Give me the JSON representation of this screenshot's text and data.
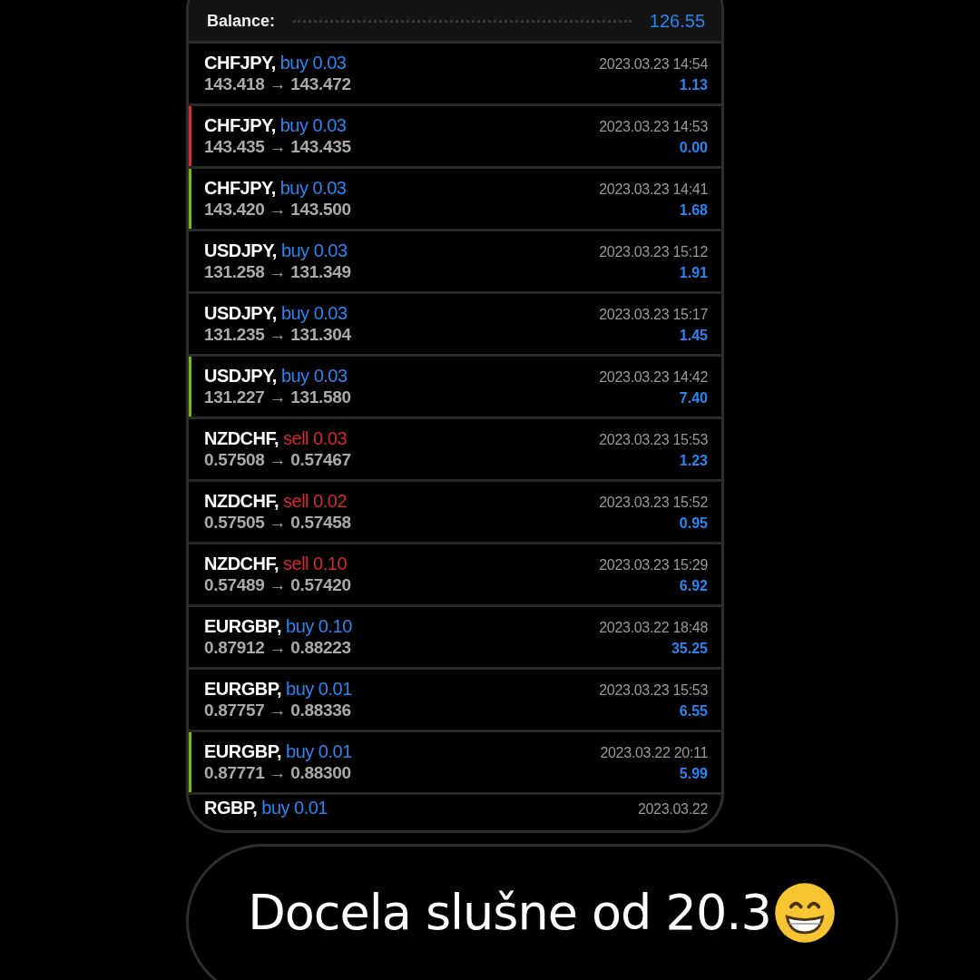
{
  "balance": {
    "label": "Balance:",
    "value": "126.55"
  },
  "trades": [
    {
      "symbol": "CHFJPY,",
      "order": "buy 0.03",
      "kind": "buy",
      "prices": "143.418 → 143.472",
      "time": "2023.03.23 14:54",
      "profit": "1.13"
    },
    {
      "symbol": "CHFJPY,",
      "order": "buy 0.03",
      "kind": "buy",
      "prices": "143.435 → 143.435",
      "time": "2023.03.23 14:53",
      "profit": "0.00",
      "color": "#d32f2f"
    },
    {
      "symbol": "CHFJPY,",
      "order": "buy 0.03",
      "kind": "buy",
      "prices": "143.420 → 143.500",
      "time": "2023.03.23 14:41",
      "profit": "1.68",
      "color": "#7cb518"
    },
    {
      "symbol": "USDJPY,",
      "order": "buy 0.03",
      "kind": "buy",
      "prices": "131.258 → 131.349",
      "time": "2023.03.23 15:12",
      "profit": "1.91"
    },
    {
      "symbol": "USDJPY,",
      "order": "buy 0.03",
      "kind": "buy",
      "prices": "131.235 → 131.304",
      "time": "2023.03.23 15:17",
      "profit": "1.45"
    },
    {
      "symbol": "USDJPY,",
      "order": "buy 0.03",
      "kind": "buy",
      "prices": "131.227 → 131.580",
      "time": "2023.03.23 14:42",
      "profit": "7.40",
      "color": "#7cb518"
    },
    {
      "symbol": "NZDCHF,",
      "order": "sell 0.03",
      "kind": "sell",
      "prices": "0.57508 → 0.57467",
      "time": "2023.03.23 15:53",
      "profit": "1.23"
    },
    {
      "symbol": "NZDCHF,",
      "order": "sell 0.02",
      "kind": "sell",
      "prices": "0.57505 → 0.57458",
      "time": "2023.03.23 15:52",
      "profit": "0.95"
    },
    {
      "symbol": "NZDCHF,",
      "order": "sell 0.10",
      "kind": "sell",
      "prices": "0.57489 → 0.57420",
      "time": "2023.03.23 15:29",
      "profit": "6.92"
    },
    {
      "symbol": "EURGBP,",
      "order": "buy 0.10",
      "kind": "buy",
      "prices": "0.87912 → 0.88223",
      "time": "2023.03.22 18:48",
      "profit": "35.25"
    },
    {
      "symbol": "EURGBP,",
      "order": "buy 0.01",
      "kind": "buy",
      "prices": "0.87757 → 0.88336",
      "time": "2023.03.23 15:53",
      "profit": "6.55"
    },
    {
      "symbol": "EURGBP,",
      "order": "buy 0.01",
      "kind": "buy",
      "prices": "0.87771 → 0.88300",
      "time": "2023.03.22 20:11",
      "profit": "5.99",
      "color": "#7cb518"
    },
    {
      "symbol": "RGBP,",
      "order": "buy 0.01",
      "kind": "buy",
      "time": "2023.03.22"
    }
  ],
  "message": {
    "text": "Docela slušne od 20.3"
  }
}
